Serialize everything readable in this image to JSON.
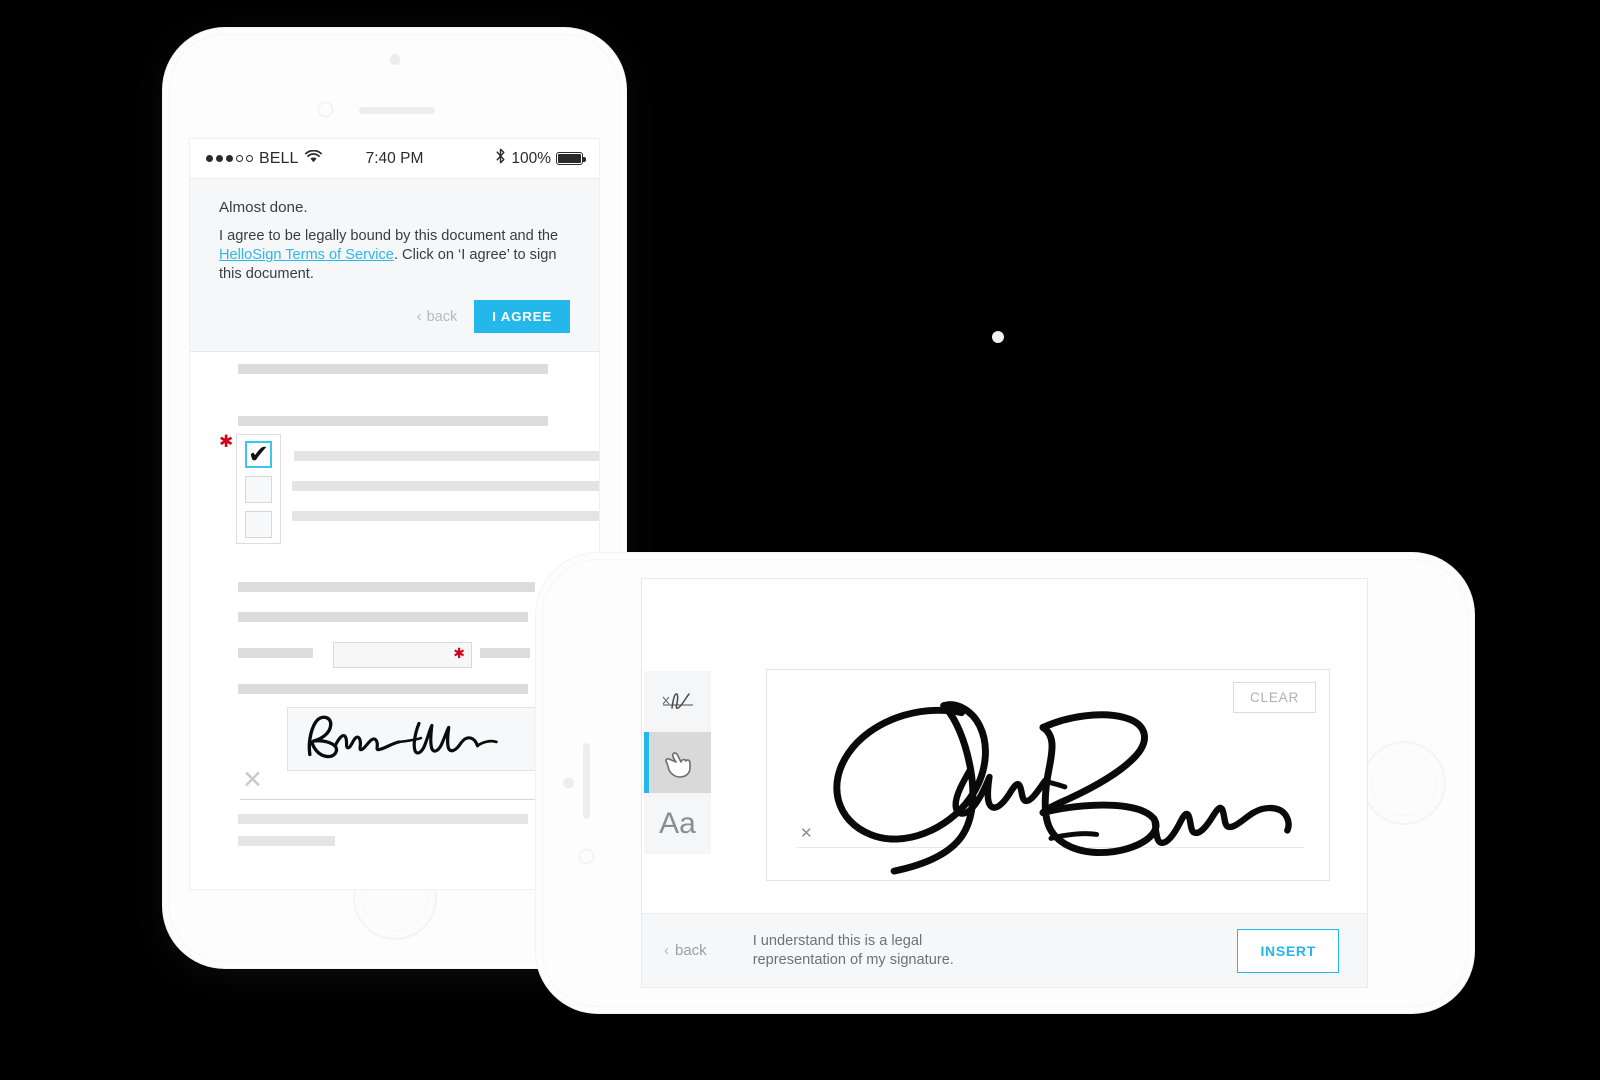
{
  "background_color": "#000000",
  "accent_color": "#24b7ea",
  "portrait_phone": {
    "status_bar": {
      "signal_dots_filled": 3,
      "signal_dots_empty": 2,
      "carrier": "BELL",
      "wifi_icon": "wifi-icon",
      "time": "7:40 PM",
      "bluetooth_icon": "bluetooth-icon",
      "battery_percent": "100%",
      "battery_icon": "battery-full-icon"
    },
    "agree_panel": {
      "title": "Almost done.",
      "body_before_link": "I agree to be legally bound by this document and the ",
      "link_text": "HelloSign Terms of Service",
      "body_after_link": ". Click on ‘I agree’ to sign this document.",
      "back_label": "back",
      "back_chevron": "chevron-left-icon",
      "agree_label": "I AGREE"
    },
    "document": {
      "required_marker": "✱",
      "checkbox_checked_mark": "✔",
      "signature_x_mark": "✕",
      "checkbox_count": 3,
      "checked_index": 0
    }
  },
  "landscape_phone": {
    "tools": [
      {
        "name": "draw-signature-tool",
        "label": "signature-line-icon",
        "active": false
      },
      {
        "name": "hand-draw-tool",
        "label": "pointing-hand-icon",
        "active": true
      },
      {
        "name": "type-signature-tool",
        "label": "Aa",
        "active": false
      }
    ],
    "signature_pad": {
      "clear_label": "CLEAR",
      "x_mark": "✕"
    },
    "footer": {
      "back_label": "back",
      "back_chevron": "chevron-left-icon",
      "legal_line_1": "I understand this is a legal",
      "legal_line_2": "representation of my signature.",
      "insert_label": "INSERT"
    }
  }
}
